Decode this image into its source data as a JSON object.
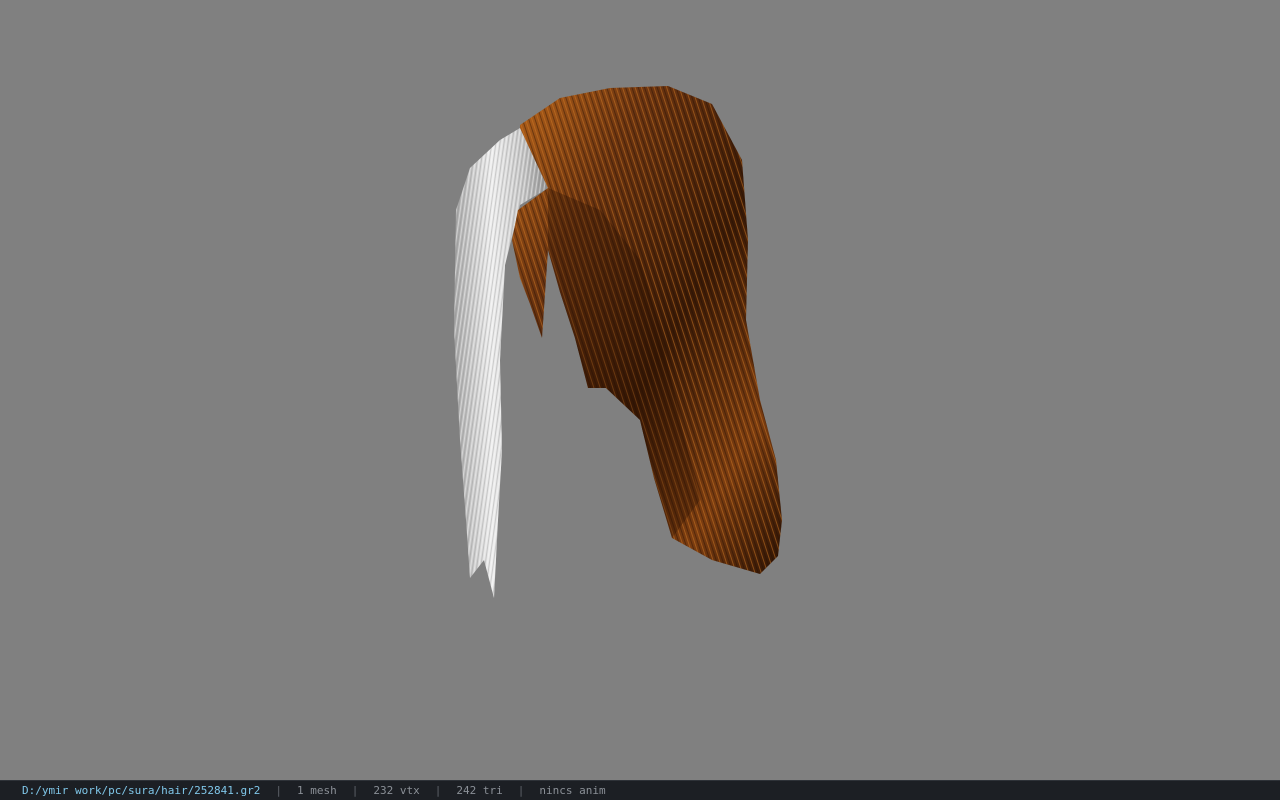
{
  "viewport": {
    "background": "#808080",
    "model": "hair-mesh"
  },
  "statusbar": {
    "file_path": "D:/ymir work/pc/sura/hair/252841.gr2",
    "separator": "|",
    "mesh_count": "1 mesh",
    "vertex_count": "232 vtx",
    "triangle_count": "242 tri",
    "animation": "nincs anim"
  },
  "colors": {
    "hair_dark": "#3a1a06",
    "hair_mid": "#6b3410",
    "hair_highlight": "#c9701e",
    "strand_light": "#e8e8e8",
    "strand_shadow": "#9a9a9a",
    "path_text": "#7fc6e8"
  }
}
